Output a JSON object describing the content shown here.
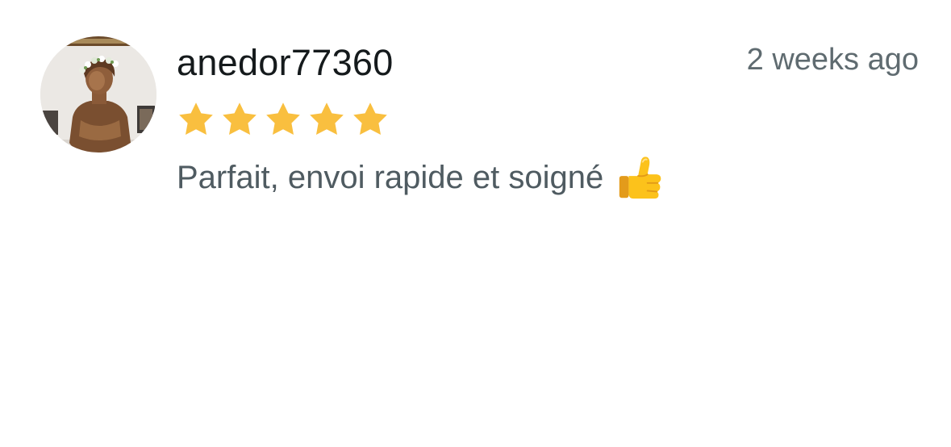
{
  "review": {
    "username": "anedor77360",
    "timestamp": "2 weeks ago",
    "rating": 5,
    "rating_max": 5,
    "comment": "Parfait, envoi rapide et soigné",
    "comment_emoji_icon": "thumbs-up-icon",
    "avatar_icon": "user-avatar-bust-photo"
  },
  "colors": {
    "star": "#f9bf3f",
    "username": "#151a1c",
    "secondary_text": "#5f6b70",
    "comment_text": "#4f5b61",
    "background": "#ffffff"
  }
}
